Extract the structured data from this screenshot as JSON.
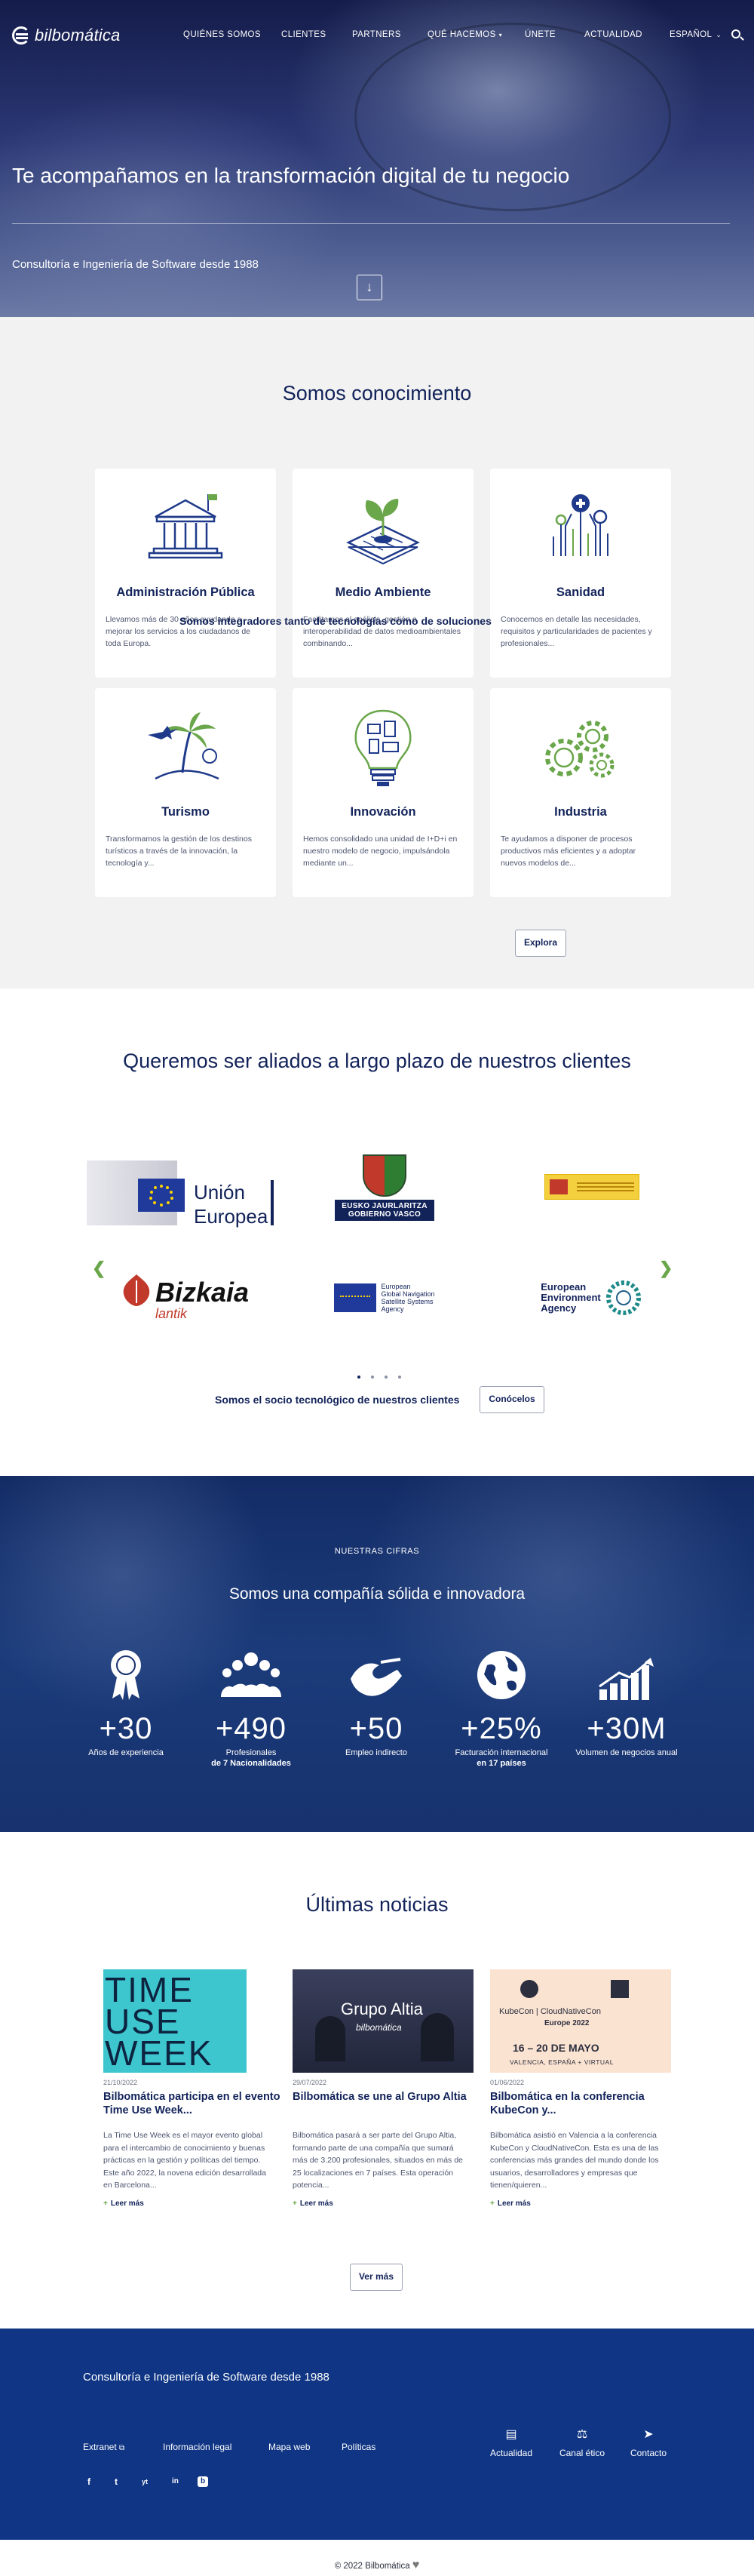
{
  "brand": {
    "name": "bilbomática"
  },
  "nav": {
    "items": [
      "QUIÉNES SOMOS",
      "CLIENTES",
      "PARTNERS",
      "QUÉ HACEMOS",
      "ÚNETE",
      "ACTUALIDAD",
      "ESPAÑOL"
    ],
    "search_icon": "search-icon"
  },
  "hero": {
    "title": "Te acompañamos en la transformación digital de tu negocio",
    "subtitle": "Consultoría e Ingeniería de Software desde 1988",
    "scroll_icon": "arrow-down-icon"
  },
  "knowledge": {
    "title": "Somos conocimiento",
    "cards": [
      {
        "title": "Administración Pública",
        "text": "Llevamos más de 30 años ayudando a mejorar los servicios a los ciudadanos de toda Europa.",
        "icon": "government-building-icon"
      },
      {
        "title": "Medio Ambiente",
        "text": "Facilitamos el análisis, gestión e interoperabilidad de datos medioambientales combinando...",
        "icon": "plant-circuit-icon"
      },
      {
        "title": "Sanidad",
        "text": "Conocemos en detalle las necesidades, requisitos y particularidades de pacientes y profesionales...",
        "icon": "health-network-icon"
      },
      {
        "title": "Turismo",
        "text": "Transformamos la gestión de los destinos turísticos a través de la innovación, la tecnología y...",
        "icon": "palm-plane-icon"
      },
      {
        "title": "Innovación",
        "text": "Hemos consolidado una unidad de I+D+i en nuestro modelo de negocio, impulsándola mediante un...",
        "icon": "lightbulb-icon"
      },
      {
        "title": "Industria",
        "text": "Te ayudamos a disponer de procesos productivos más eficientes y a adoptar nuevos modelos de...",
        "icon": "gears-icon"
      }
    ],
    "integrators_text": "Somos integradores tanto de tecnologías como de soluciones",
    "explore_label": "Explora"
  },
  "allies": {
    "title": "Queremos ser aliados a largo plazo de nuestros clientes",
    "logos": [
      {
        "name": "Unión Europea",
        "line1": "Unión",
        "line2": "Europea"
      },
      {
        "name": "Eusko Jaurlaritza Gobierno Vasco",
        "line1": "EUSKO JAURLARITZA",
        "line2": "GOBIERNO VASCO"
      },
      {
        "name": "Gobierno de España",
        "line1": "",
        "line2": ""
      },
      {
        "name": "Bizkaia lantik",
        "line1": "Bizkaia",
        "line2": "lantik"
      },
      {
        "name": "European Global Navigation Satellite Systems Agency",
        "line1": "European",
        "line2": "Global Navigation",
        "line3": "Satellite Systems",
        "line4": "Agency"
      },
      {
        "name": "European Environment Agency",
        "line1": "European",
        "line2": "Environment",
        "line3": "Agency"
      }
    ],
    "partner_text": "Somos el socio tecnológico de nuestros clientes",
    "button_label": "Conócelos"
  },
  "figures": {
    "kicker": "NUESTRAS CIFRAS",
    "title": "Somos una compañía sólida e innovadora",
    "stats": [
      {
        "value": "+30",
        "label": "Años de experiencia",
        "bold": "",
        "icon": "award-ribbon-icon"
      },
      {
        "value": "+490",
        "label": "Profesionales",
        "bold": "de 7 Nacionalidades",
        "icon": "people-group-icon"
      },
      {
        "value": "+50",
        "label": "Empleo indirecto",
        "bold": "",
        "icon": "handshake-icon"
      },
      {
        "value": "+25%",
        "label": "Facturación internacional",
        "bold": "en 17 países",
        "icon": "globe-icon"
      },
      {
        "value": "+30M",
        "label": "Volumen de negocios anual",
        "bold": "",
        "icon": "growth-chart-icon"
      }
    ]
  },
  "news": {
    "title": "Últimas noticias",
    "items": [
      {
        "date": "21/10/2022",
        "title": "Bilbomática participa en el evento Time Use Week...",
        "text": "La Time Use Week es el mayor evento global para el intercambio de conocimiento y buenas prácticas en la gestión y políticas del tiempo. Este año 2022, la novena edición desarrollada en Barcelona...",
        "more": "Leer más",
        "img_text": [
          "TIME",
          "USE",
          "WEEK"
        ]
      },
      {
        "date": "29/07/2022",
        "title": "Bilbomática se une al Grupo Altia",
        "text": "Bilbomática pasará a ser parte del Grupo Altia, formando parte de una compañía que sumará más de 3.200 profesionales, situados en más de 25 localizaciones en 7 países. Esta operación potencia...",
        "more": "Leer más",
        "img_text": [
          "Grupo Altia",
          "bilbomática"
        ]
      },
      {
        "date": "01/06/2022",
        "title": "Bilbomática en la conferencia KubeCon y...",
        "text": "Bilbomática asistió en Valencia a la conferencia KubeCon y CloudNativeCon. Esta es una de las conferencias más grandes del mundo donde los usuarios, desarrolladores y empresas que tienen/quieren...",
        "more": "Leer más",
        "img_text": [
          "KubeCon",
          "CloudNativeCon",
          "Europe 2022",
          "16 – 20 DE MAYO",
          "VALENCIA, ESPAÑA + VIRTUAL"
        ]
      }
    ],
    "more_label": "Ver más"
  },
  "footer": {
    "tagline": "Consultoría e Ingeniería de Software desde 1988",
    "links": [
      "Extranet",
      "Información legal",
      "Mapa web",
      "Políticas"
    ],
    "social": [
      "f",
      "t",
      "yt",
      "in",
      "b"
    ],
    "actions": [
      {
        "label": "Actualidad",
        "icon": "newspaper-icon"
      },
      {
        "label": "Canal ético",
        "icon": "scales-icon"
      },
      {
        "label": "Contacto",
        "icon": "paper-plane-icon"
      }
    ]
  },
  "copyright": "© 2022 Bilbomática",
  "colors": {
    "navy": "#12235a",
    "footer_blue": "#0f3584",
    "green": "#6aa64a",
    "light_bg": "#f2f2f2"
  }
}
